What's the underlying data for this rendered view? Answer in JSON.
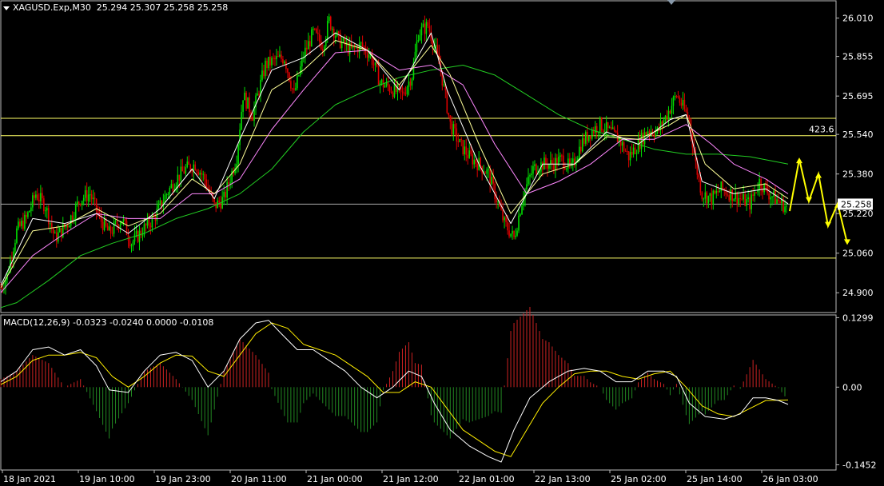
{
  "header": {
    "symbol_line": "XAGUSD.Exp,M30  25.294 25.307 25.258 25.258",
    "macd_line": "MACD(12,26,9) -0.0323 -0.0240 0.0000 -0.0108"
  },
  "colors": {
    "background": "#000000",
    "bull_candle": "#00dd00",
    "bear_candle": "#dd0000",
    "ma_fast": "#ffffff",
    "ma_mid": "#ffff99",
    "ma_slow": "#ff88ff",
    "ma_long": "#22cc22",
    "level_line": "#ffff66",
    "bid_line": "#aaaaaa",
    "projection": "#ffff00",
    "macd_line": "#ffffff",
    "signal_line": "#ffee00",
    "hist_pos": "#cc2222",
    "hist_neg": "#228822"
  },
  "chart_data": [
    {
      "type": "candlestick",
      "title": "XAGUSD.Exp,M30",
      "ylim": [
        24.82,
        26.08
      ],
      "y_ticks": [
        "26.010",
        "25.855",
        "25.695",
        "25.540",
        "25.380",
        "25.220",
        "25.060",
        "24.900"
      ],
      "y_tick_values": [
        26.01,
        25.855,
        25.695,
        25.54,
        25.38,
        25.22,
        25.06,
        24.9
      ],
      "x_ticks": [
        "18 Jan 2021",
        "19 Jan 10:00",
        "19 Jan 23:00",
        "20 Jan 11:00",
        "21 Jan 00:00",
        "21 Jan 12:00",
        "22 Jan 01:00",
        "22 Jan 13:00",
        "25 Jan 02:00",
        "25 Jan 14:00",
        "26 Jan 03:00"
      ],
      "levels": [
        25.605,
        25.535,
        25.04
      ],
      "level_label": "423.6",
      "current_price": 25.258,
      "current_price_label": "25.258",
      "close_path": [
        [
          0,
          24.92
        ],
        [
          4,
          24.97
        ],
        [
          10,
          25.15
        ],
        [
          16,
          25.2
        ],
        [
          22,
          25.3
        ],
        [
          28,
          25.25
        ],
        [
          34,
          25.12
        ],
        [
          42,
          25.18
        ],
        [
          50,
          25.28
        ],
        [
          56,
          25.3
        ],
        [
          62,
          25.2
        ],
        [
          68,
          25.14
        ],
        [
          76,
          25.2
        ],
        [
          82,
          25.1
        ],
        [
          90,
          25.16
        ],
        [
          96,
          25.2
        ],
        [
          104,
          25.3
        ],
        [
          110,
          25.36
        ],
        [
          116,
          25.4
        ],
        [
          122,
          25.42
        ],
        [
          128,
          25.36
        ],
        [
          134,
          25.25
        ],
        [
          140,
          25.28
        ],
        [
          148,
          25.45
        ],
        [
          152,
          25.7
        ],
        [
          158,
          25.62
        ],
        [
          166,
          25.82
        ],
        [
          172,
          25.84
        ],
        [
          178,
          25.85
        ],
        [
          184,
          25.7
        ],
        [
          190,
          25.86
        ],
        [
          196,
          25.95
        ],
        [
          202,
          25.9
        ],
        [
          206,
          26.0
        ],
        [
          212,
          25.92
        ],
        [
          220,
          25.88
        ],
        [
          226,
          25.9
        ],
        [
          232,
          25.86
        ],
        [
          238,
          25.75
        ],
        [
          246,
          25.72
        ],
        [
          252,
          25.7
        ],
        [
          258,
          25.78
        ],
        [
          262,
          25.95
        ],
        [
          268,
          25.98
        ],
        [
          272,
          25.9
        ],
        [
          276,
          25.8
        ],
        [
          282,
          25.58
        ],
        [
          288,
          25.5
        ],
        [
          294,
          25.45
        ],
        [
          300,
          25.42
        ],
        [
          306,
          25.38
        ],
        [
          310,
          25.3
        ],
        [
          316,
          25.18
        ],
        [
          322,
          25.12
        ],
        [
          328,
          25.3
        ],
        [
          334,
          25.4
        ],
        [
          340,
          25.42
        ],
        [
          346,
          25.42
        ],
        [
          352,
          25.44
        ],
        [
          358,
          25.4
        ],
        [
          364,
          25.5
        ],
        [
          370,
          25.55
        ],
        [
          376,
          25.58
        ],
        [
          382,
          25.55
        ],
        [
          388,
          25.52
        ],
        [
          394,
          25.45
        ],
        [
          400,
          25.5
        ],
        [
          406,
          25.56
        ],
        [
          412,
          25.55
        ],
        [
          418,
          25.62
        ],
        [
          424,
          25.7
        ],
        [
          428,
          25.65
        ],
        [
          432,
          25.6
        ],
        [
          436,
          25.42
        ],
        [
          440,
          25.3
        ],
        [
          446,
          25.28
        ],
        [
          452,
          25.32
        ],
        [
          458,
          25.3
        ],
        [
          464,
          25.28
        ],
        [
          470,
          25.26
        ],
        [
          476,
          25.35
        ],
        [
          482,
          25.3
        ],
        [
          488,
          25.27
        ],
        [
          494,
          25.24
        ]
      ],
      "n_bars": 494,
      "ma_fast": [
        [
          0,
          24.93
        ],
        [
          20,
          25.2
        ],
        [
          40,
          25.18
        ],
        [
          60,
          25.22
        ],
        [
          80,
          25.14
        ],
        [
          100,
          25.24
        ],
        [
          120,
          25.4
        ],
        [
          134,
          25.28
        ],
        [
          150,
          25.52
        ],
        [
          170,
          25.8
        ],
        [
          190,
          25.85
        ],
        [
          210,
          25.95
        ],
        [
          230,
          25.88
        ],
        [
          250,
          25.72
        ],
        [
          270,
          25.95
        ],
        [
          280,
          25.72
        ],
        [
          300,
          25.42
        ],
        [
          320,
          25.18
        ],
        [
          340,
          25.42
        ],
        [
          360,
          25.42
        ],
        [
          380,
          25.55
        ],
        [
          400,
          25.5
        ],
        [
          420,
          25.6
        ],
        [
          430,
          25.62
        ],
        [
          440,
          25.35
        ],
        [
          460,
          25.3
        ],
        [
          480,
          25.32
        ],
        [
          494,
          25.26
        ]
      ],
      "ma_mid": [
        [
          0,
          24.92
        ],
        [
          20,
          25.15
        ],
        [
          40,
          25.17
        ],
        [
          60,
          25.24
        ],
        [
          80,
          25.17
        ],
        [
          100,
          25.22
        ],
        [
          120,
          25.36
        ],
        [
          134,
          25.3
        ],
        [
          150,
          25.42
        ],
        [
          170,
          25.72
        ],
        [
          190,
          25.8
        ],
        [
          210,
          25.92
        ],
        [
          230,
          25.88
        ],
        [
          250,
          25.74
        ],
        [
          270,
          25.9
        ],
        [
          282,
          25.78
        ],
        [
          300,
          25.5
        ],
        [
          320,
          25.22
        ],
        [
          340,
          25.38
        ],
        [
          360,
          25.42
        ],
        [
          380,
          25.53
        ],
        [
          400,
          25.52
        ],
        [
          420,
          25.58
        ],
        [
          430,
          25.62
        ],
        [
          442,
          25.42
        ],
        [
          460,
          25.32
        ],
        [
          480,
          25.34
        ],
        [
          494,
          25.28
        ]
      ],
      "ma_slow": [
        [
          0,
          24.9
        ],
        [
          20,
          25.05
        ],
        [
          40,
          25.14
        ],
        [
          60,
          25.22
        ],
        [
          80,
          25.2
        ],
        [
          100,
          25.2
        ],
        [
          120,
          25.3
        ],
        [
          134,
          25.3
        ],
        [
          150,
          25.36
        ],
        [
          170,
          25.56
        ],
        [
          190,
          25.72
        ],
        [
          210,
          25.87
        ],
        [
          230,
          25.88
        ],
        [
          250,
          25.8
        ],
        [
          270,
          25.82
        ],
        [
          290,
          25.74
        ],
        [
          310,
          25.5
        ],
        [
          330,
          25.3
        ],
        [
          350,
          25.35
        ],
        [
          370,
          25.42
        ],
        [
          390,
          25.52
        ],
        [
          410,
          25.52
        ],
        [
          430,
          25.58
        ],
        [
          446,
          25.5
        ],
        [
          460,
          25.42
        ],
        [
          480,
          25.36
        ],
        [
          494,
          25.3
        ]
      ],
      "ma_long": [
        [
          0,
          24.84
        ],
        [
          10,
          24.86
        ],
        [
          30,
          24.95
        ],
        [
          50,
          25.05
        ],
        [
          70,
          25.1
        ],
        [
          90,
          25.14
        ],
        [
          110,
          25.2
        ],
        [
          130,
          25.24
        ],
        [
          150,
          25.3
        ],
        [
          170,
          25.4
        ],
        [
          190,
          25.55
        ],
        [
          210,
          25.66
        ],
        [
          230,
          25.72
        ],
        [
          250,
          25.77
        ],
        [
          270,
          25.8
        ],
        [
          290,
          25.82
        ],
        [
          310,
          25.78
        ],
        [
          330,
          25.7
        ],
        [
          350,
          25.62
        ],
        [
          370,
          25.56
        ],
        [
          390,
          25.52
        ],
        [
          410,
          25.48
        ],
        [
          430,
          25.46
        ],
        [
          450,
          25.46
        ],
        [
          470,
          25.45
        ],
        [
          494,
          25.42
        ]
      ],
      "projection": [
        [
          25.23,
          0
        ],
        [
          25.44,
          1
        ],
        [
          25.27,
          2
        ],
        [
          25.38,
          3
        ],
        [
          25.17,
          4
        ],
        [
          25.26,
          5
        ],
        [
          25.1,
          6
        ]
      ]
    },
    {
      "type": "macd",
      "title": "MACD(12,26,9)",
      "ylim": [
        -0.155,
        0.135
      ],
      "y_ticks": [
        "0.1299",
        "0.00",
        "-0.1452"
      ],
      "y_tick_values": [
        0.1299,
        0.0,
        -0.1452
      ],
      "macd": [
        [
          0,
          0.01
        ],
        [
          10,
          0.03
        ],
        [
          20,
          0.07
        ],
        [
          30,
          0.075
        ],
        [
          40,
          0.06
        ],
        [
          50,
          0.07
        ],
        [
          60,
          0.04
        ],
        [
          68,
          -0.005
        ],
        [
          80,
          -0.01
        ],
        [
          90,
          0.03
        ],
        [
          100,
          0.06
        ],
        [
          110,
          0.065
        ],
        [
          120,
          0.05
        ],
        [
          130,
          0.0
        ],
        [
          140,
          0.03
        ],
        [
          150,
          0.09
        ],
        [
          160,
          0.12
        ],
        [
          168,
          0.125
        ],
        [
          176,
          0.1
        ],
        [
          186,
          0.07
        ],
        [
          196,
          0.07
        ],
        [
          206,
          0.05
        ],
        [
          216,
          0.03
        ],
        [
          226,
          0.0
        ],
        [
          236,
          -0.02
        ],
        [
          246,
          0.0
        ],
        [
          256,
          0.03
        ],
        [
          264,
          0.02
        ],
        [
          272,
          -0.03
        ],
        [
          282,
          -0.08
        ],
        [
          294,
          -0.11
        ],
        [
          306,
          -0.13
        ],
        [
          314,
          -0.14
        ],
        [
          322,
          -0.08
        ],
        [
          332,
          -0.02
        ],
        [
          344,
          0.01
        ],
        [
          356,
          0.03
        ],
        [
          366,
          0.035
        ],
        [
          376,
          0.03
        ],
        [
          386,
          0.01
        ],
        [
          396,
          0.01
        ],
        [
          406,
          0.03
        ],
        [
          416,
          0.03
        ],
        [
          424,
          0.02
        ],
        [
          432,
          -0.03
        ],
        [
          442,
          -0.055
        ],
        [
          454,
          -0.06
        ],
        [
          464,
          -0.05
        ],
        [
          472,
          -0.02
        ],
        [
          480,
          -0.02
        ],
        [
          488,
          -0.025
        ],
        [
          494,
          -0.0323
        ]
      ],
      "signal": [
        [
          0,
          0.005
        ],
        [
          10,
          0.02
        ],
        [
          20,
          0.05
        ],
        [
          30,
          0.06
        ],
        [
          40,
          0.06
        ],
        [
          50,
          0.065
        ],
        [
          60,
          0.055
        ],
        [
          70,
          0.02
        ],
        [
          80,
          0.0
        ],
        [
          90,
          0.02
        ],
        [
          100,
          0.045
        ],
        [
          110,
          0.06
        ],
        [
          120,
          0.058
        ],
        [
          130,
          0.03
        ],
        [
          140,
          0.02
        ],
        [
          150,
          0.06
        ],
        [
          160,
          0.1
        ],
        [
          170,
          0.12
        ],
        [
          180,
          0.11
        ],
        [
          190,
          0.08
        ],
        [
          200,
          0.07
        ],
        [
          210,
          0.06
        ],
        [
          220,
          0.04
        ],
        [
          230,
          0.02
        ],
        [
          240,
          -0.01
        ],
        [
          250,
          -0.01
        ],
        [
          260,
          0.01
        ],
        [
          270,
          0.0
        ],
        [
          280,
          -0.04
        ],
        [
          290,
          -0.08
        ],
        [
          300,
          -0.1
        ],
        [
          310,
          -0.12
        ],
        [
          320,
          -0.13
        ],
        [
          330,
          -0.08
        ],
        [
          340,
          -0.03
        ],
        [
          350,
          0.0
        ],
        [
          360,
          0.025
        ],
        [
          370,
          0.03
        ],
        [
          380,
          0.03
        ],
        [
          390,
          0.02
        ],
        [
          400,
          0.015
        ],
        [
          410,
          0.025
        ],
        [
          420,
          0.03
        ],
        [
          430,
          0.0
        ],
        [
          440,
          -0.035
        ],
        [
          450,
          -0.05
        ],
        [
          460,
          -0.055
        ],
        [
          470,
          -0.04
        ],
        [
          480,
          -0.025
        ],
        [
          494,
          -0.024
        ]
      ]
    }
  ]
}
